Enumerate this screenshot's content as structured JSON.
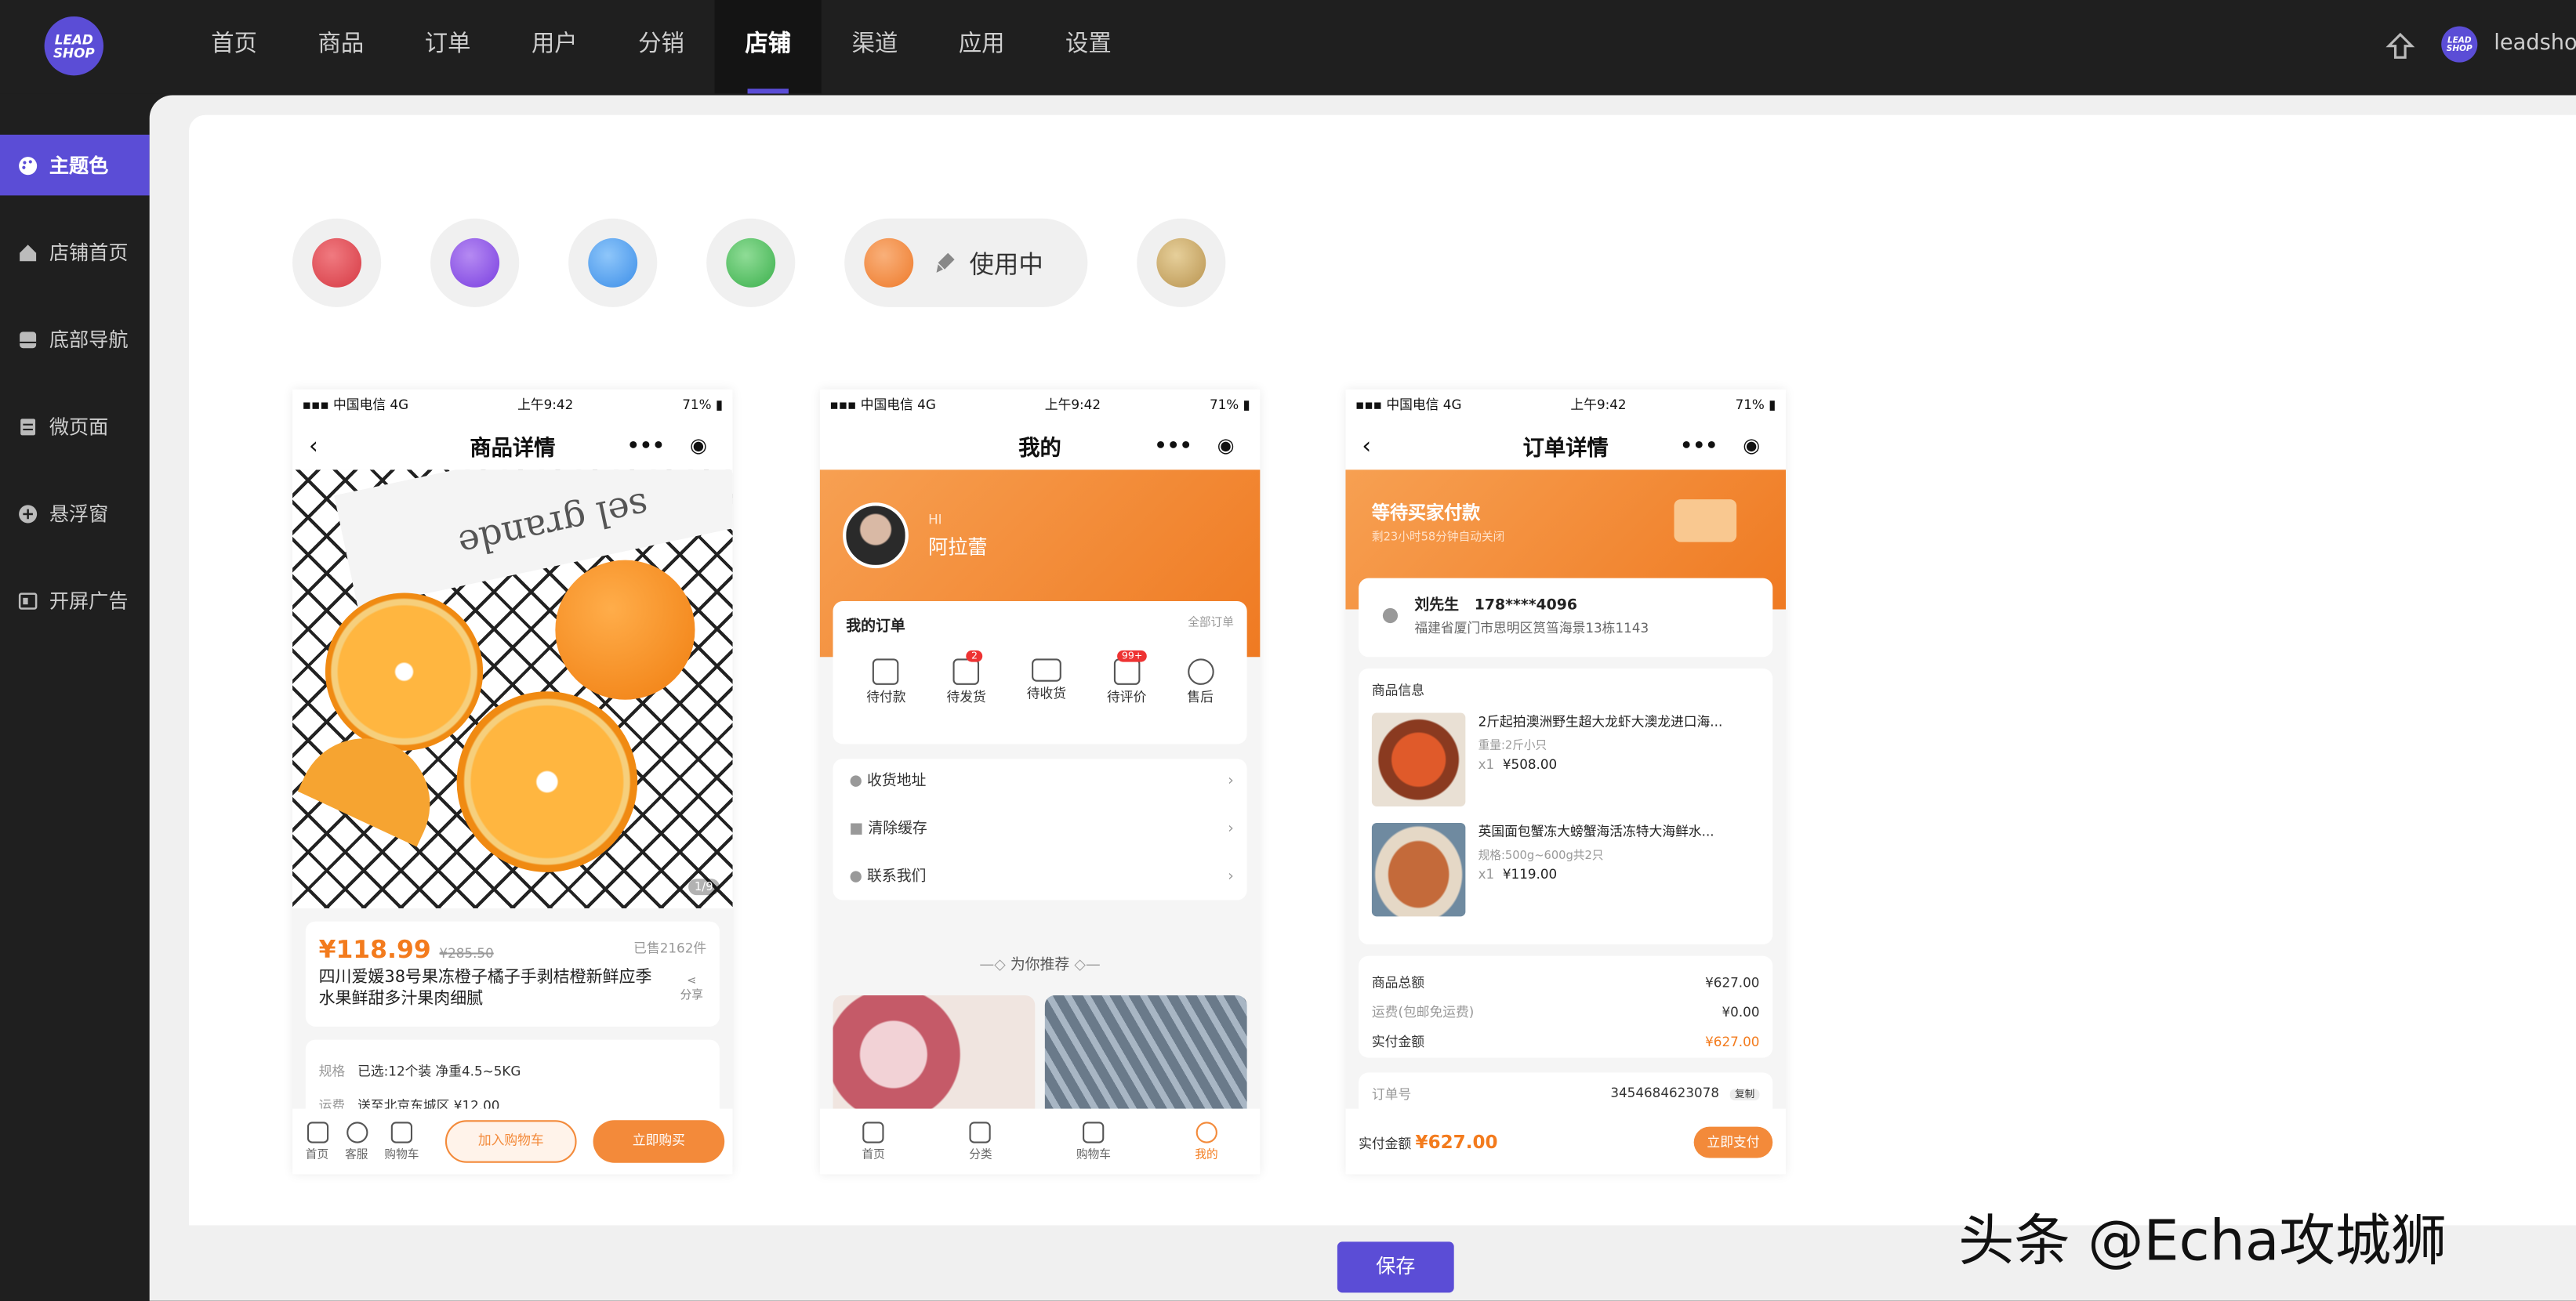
{
  "app": {
    "logo_text": "LEAD SHOP",
    "user": "leadshop"
  },
  "nav": [
    "首页",
    "商品",
    "订单",
    "用户",
    "分销",
    "店铺",
    "渠道",
    "应用",
    "设置"
  ],
  "sidebar": [
    "主题色",
    "店铺首页",
    "底部导航",
    "微页面",
    "悬浮窗",
    "开屏广告"
  ],
  "theme": {
    "colors": [
      "#e04a52",
      "#8d52e6",
      "#4a9ef0",
      "#4cbf5c",
      "#f38a3a",
      "#c9a662"
    ],
    "in_use_label": "使用中",
    "active_index": 4,
    "accent": "#5b4dd6"
  },
  "status": {
    "carrier": "中国电信",
    "net": "4G",
    "time": "上午9:42",
    "battery": "71%"
  },
  "product": {
    "title": "商品详情",
    "price": "¥118.99",
    "orig": "¥285.50",
    "sold": "已售2162件",
    "name": "四川爱媛38号果冻橙子橘子手剥桔橙新鲜应季水果鲜甜多汁果肉细腻",
    "share": "分享",
    "img_idx": "1/9",
    "spec_label": "规格",
    "spec_val": "已选:12个装 净重4.5~5KG",
    "ship_label": "运费",
    "ship_val": "送至北京东城区 ¥12.00",
    "nav": [
      "首页",
      "客服",
      "购物车"
    ],
    "cart_btn": "加入购物车",
    "buy_btn": "立即购买",
    "lettering": "sel grande"
  },
  "mine": {
    "title": "我的",
    "hi": "HI",
    "user": "阿拉蕾",
    "orders": "我的订单",
    "all_orders": "全部订单",
    "order_tabs": [
      "待付款",
      "待发货",
      "待收货",
      "待评价",
      "售后"
    ],
    "badge1": "2",
    "badge2": "99+",
    "rows": [
      "收货地址",
      "清除缓存",
      "联系我们"
    ],
    "recommend": "为你推荐",
    "nav": [
      "首页",
      "分类",
      "购物车",
      "我的"
    ]
  },
  "order": {
    "title": "订单详情",
    "status": "等待买家付款",
    "countdown": "剩23小时58分钟自动关闭",
    "name": "刘先生",
    "phone": "178****4096",
    "addr": "福建省厦门市思明区筼筜海景13栋1143",
    "goods_title": "商品信息",
    "items": [
      {
        "name": "2斤起拍澳洲野生超大龙虾大澳龙进口海...",
        "spec": "重量:2斤小只",
        "qty": "x1",
        "price": "¥508.00"
      },
      {
        "name": "英国面包蟹冻大螃蟹海活冻特大海鲜水...",
        "spec": "规格:500g~600g共2只",
        "qty": "x1",
        "price": "¥119.00"
      }
    ],
    "sum_rows": [
      [
        "商品总额",
        "¥627.00"
      ],
      [
        "运费(包邮免运费)",
        "¥0.00"
      ],
      [
        "实付金额",
        "¥627.00"
      ]
    ],
    "order_no_label": "订单号",
    "order_no": "3454684623078",
    "copy": "复制",
    "pay_label": "实付金额",
    "pay_amount": "¥627.00",
    "pay_btn": "立即支付"
  },
  "save": "保存",
  "watermark": "头条 @Echa攻城狮"
}
